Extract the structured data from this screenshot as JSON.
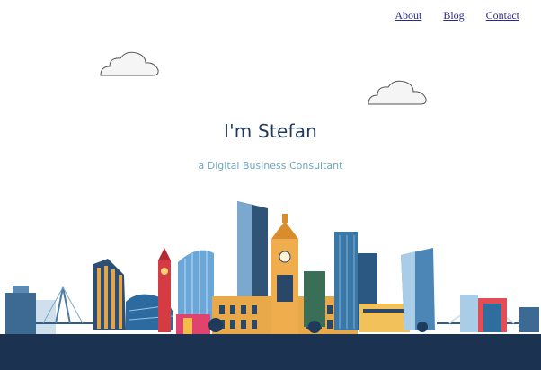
{
  "nav": {
    "items": [
      "About",
      "Blog",
      "Contact"
    ]
  },
  "hero": {
    "title": "I'm Stefan",
    "subtitle": "a Digital Business Consultant"
  },
  "colors": {
    "title": "#1f3a5a",
    "subtitle": "#6fa7bf",
    "ground": "#1b3350"
  },
  "icons": [
    "cloud-icon",
    "cloud-icon",
    "city-skyline-illustration"
  ]
}
